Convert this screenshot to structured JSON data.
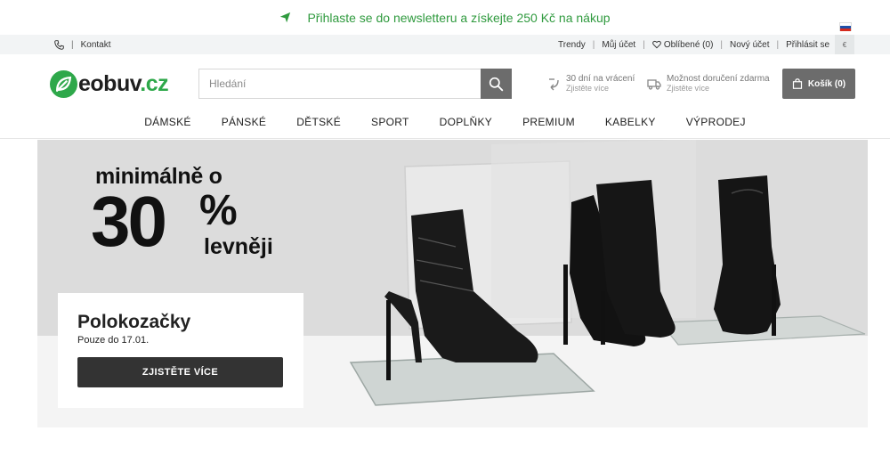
{
  "newsletter": {
    "text": "Přihlaste se do newsletteru a získejte 250 Kč na nákup",
    "icon": "paper-plane-icon",
    "color": "#2f9a3e"
  },
  "utilbar": {
    "contact_label": "Kontakt",
    "links": [
      "Trendy",
      "Můj účet",
      "Oblíbené (0)",
      "Nový účet",
      "Přihlásit se"
    ],
    "currency": "€"
  },
  "header": {
    "logo_main": "eobuv",
    "logo_tld": ".cz",
    "search_placeholder": "Hledání",
    "perks": [
      {
        "title": "30 dní na vrácení",
        "sub": "Zjistěte více",
        "icon": "return-arrow-icon"
      },
      {
        "title": "Možnost doručení zdarma",
        "sub": "Zjistěte více",
        "icon": "truck-icon"
      }
    ],
    "cart_label": "Košík (0)"
  },
  "nav": {
    "items": [
      "DÁMSKÉ",
      "PÁNSKÉ",
      "DĚTSKÉ",
      "SPORT",
      "DOPLŇKY",
      "PREMIUM",
      "KABELKY",
      "VÝPRODEJ"
    ]
  },
  "hero": {
    "headline": "minimálně o",
    "discount_number": "30",
    "discount_percent": "%",
    "discount_sub": "levněji",
    "card_title": "Polokozačky",
    "card_date": "Pouze do 17.01.",
    "card_button": "ZJISTĚTE VÍCE"
  },
  "colors": {
    "brand_green": "#2ea84a",
    "button_dark": "#333333",
    "search_button": "#6c6c6c"
  }
}
